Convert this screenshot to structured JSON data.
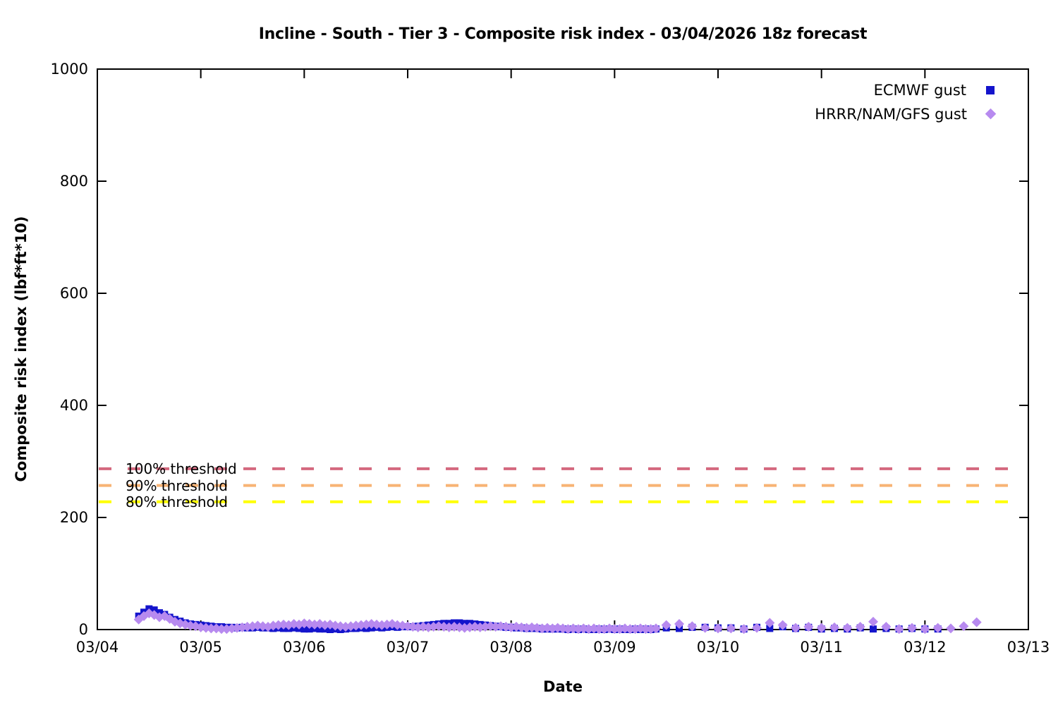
{
  "title": "Incline - South - Tier 3 - Composite risk index - 03/04/2026 18z forecast",
  "x_axis_label": "Date",
  "y_axis_label": "Composite risk index (lbf*ft*10)",
  "legend": {
    "entries": [
      {
        "label": "ECMWF gust",
        "marker": "square",
        "color": "#1414cc"
      },
      {
        "label": "HRRR/NAM/GFS gust",
        "marker": "diamond",
        "color": "#b78aef"
      }
    ]
  },
  "thresholds": [
    {
      "label": "100% threshold",
      "value": 287,
      "color": "#d4687e"
    },
    {
      "label": "90% threshold",
      "value": 257,
      "color": "#f7b374"
    },
    {
      "label": "80% threshold",
      "value": 228,
      "color": "#ffff00"
    }
  ],
  "chart_data": {
    "type": "scatter",
    "title": "Incline - South - Tier 3 - Composite risk index - 03/04/2026 18z forecast",
    "xlabel": "Date",
    "ylabel": "Composite risk index (lbf*ft*10)",
    "x_unit": "days after 03/04",
    "xlim": [
      0,
      9
    ],
    "ylim": [
      0,
      1000
    ],
    "grid": false,
    "legend_position": "top-right-inside",
    "x_ticks": [
      {
        "pos": 0,
        "label": "03/04"
      },
      {
        "pos": 1,
        "label": "03/05"
      },
      {
        "pos": 2,
        "label": "03/06"
      },
      {
        "pos": 3,
        "label": "03/07"
      },
      {
        "pos": 4,
        "label": "03/08"
      },
      {
        "pos": 5,
        "label": "03/09"
      },
      {
        "pos": 6,
        "label": "03/10"
      },
      {
        "pos": 7,
        "label": "03/11"
      },
      {
        "pos": 8,
        "label": "03/12"
      },
      {
        "pos": 9,
        "label": "03/13"
      }
    ],
    "y_ticks": [
      0,
      200,
      400,
      600,
      800,
      1000
    ],
    "series": [
      {
        "name": "ECMWF gust",
        "marker": "square",
        "color": "#1414cc",
        "segments": [
          {
            "x_start": 0.4,
            "x_step": 0.05,
            "values": [
              24,
              31,
              37,
              35,
              30,
              27,
              22,
              18,
              15,
              12,
              10,
              9,
              8,
              7,
              6,
              5,
              5,
              4,
              4,
              3,
              4,
              3,
              3,
              4,
              3,
              3,
              2,
              3,
              2,
              2,
              3,
              2,
              1,
              1,
              2,
              1,
              1,
              0,
              1,
              0,
              1,
              2,
              2,
              3,
              2,
              3,
              4,
              3,
              4,
              5,
              4,
              5,
              5,
              5,
              6,
              7,
              8,
              9,
              10,
              11,
              11,
              12,
              12,
              11,
              11,
              10,
              9,
              8,
              7,
              6,
              5,
              4,
              4,
              3,
              3,
              2,
              2,
              2,
              1,
              1,
              1,
              1,
              1,
              0,
              1,
              0,
              1,
              0,
              0,
              1,
              0,
              1,
              0,
              1,
              0,
              0,
              1,
              0,
              1,
              0,
              1
            ]
          },
          {
            "x_start": 5.5,
            "x_step": 0.125,
            "values": [
              3,
              2,
              4,
              4,
              3,
              3,
              1,
              4,
              2,
              5,
              2,
              4,
              1,
              2,
              1,
              3,
              1,
              2,
              1,
              2,
              1,
              1
            ]
          }
        ]
      },
      {
        "name": "HRRR/NAM/GFS gust",
        "marker": "diamond",
        "color": "#b78aef",
        "segments": [
          {
            "x_start": 0.4,
            "x_step": 0.05,
            "values": [
              18,
              24,
              29,
              26,
              22,
              24,
              19,
              14,
              11,
              9,
              7,
              6,
              4,
              3,
              2,
              2,
              1,
              1,
              2,
              3,
              4,
              5,
              6,
              7,
              6,
              5,
              7,
              8,
              9,
              8,
              10,
              9,
              11,
              10,
              9,
              10,
              8,
              9,
              7,
              6,
              5,
              6,
              7,
              8,
              9,
              10,
              9,
              8,
              9,
              10,
              8,
              7,
              6,
              5,
              4,
              5,
              4,
              5,
              6,
              5,
              4,
              5,
              4,
              3,
              4,
              5,
              4,
              5,
              6,
              5,
              6,
              5,
              4,
              5,
              4,
              3,
              4,
              3,
              2,
              3,
              2,
              3,
              2,
              1,
              2,
              1,
              2,
              1,
              2,
              1,
              1,
              2,
              1,
              1,
              2,
              1,
              1,
              2,
              1,
              1,
              2
            ]
          },
          {
            "x_start": 5.5,
            "x_step": 0.125,
            "values": [
              8,
              10,
              6,
              3,
              2,
              2,
              1,
              3,
              12,
              8,
              3,
              5,
              3,
              4,
              3,
              5,
              14,
              5,
              1,
              3,
              1,
              3,
              2,
              6,
              13
            ]
          }
        ]
      }
    ]
  }
}
